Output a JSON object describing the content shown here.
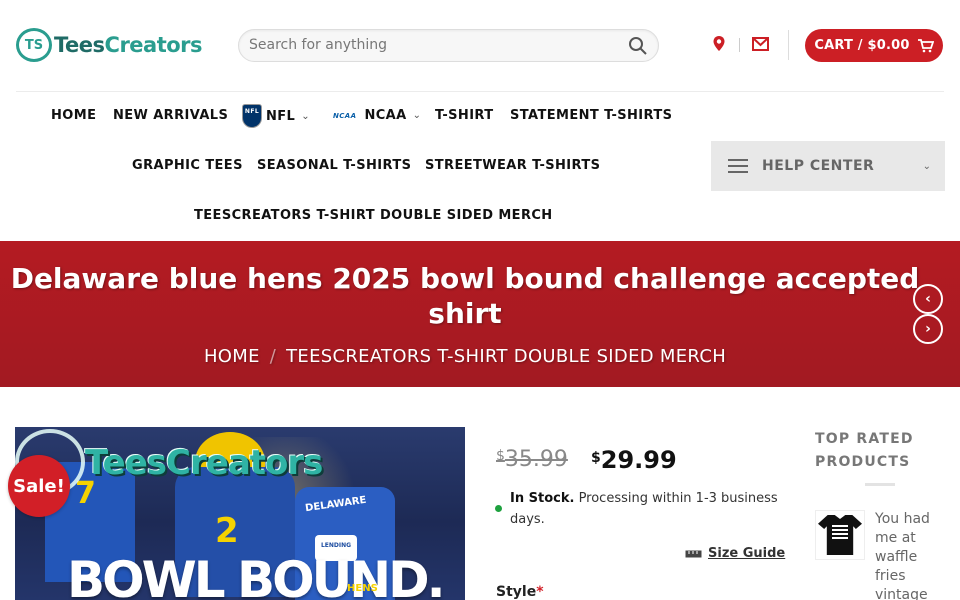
{
  "header": {
    "logo_mark": "TS",
    "logo_text_1": "Tees",
    "logo_text_2": "Creators",
    "search_placeholder": "Search for anything",
    "cart_label": "CART / $0.00"
  },
  "nav": {
    "row1": [
      "HOME",
      "NEW ARRIVALS",
      "NFL",
      "NCAA",
      "T-SHIRT",
      "STATEMENT T-SHIRTS"
    ],
    "row2": [
      "GRAPHIC TEES",
      "SEASONAL T-SHIRTS",
      "STREETWEAR T-SHIRTS"
    ],
    "row3": [
      "TEESCREATORS T-SHIRT DOUBLE SIDED MERCH"
    ],
    "nfl_badge": "NFL",
    "ncaa_badge": "NCAA",
    "help_center": "HELP CENTER"
  },
  "banner": {
    "title": "Delaware blue hens 2025 bowl bound challenge accepted shirt",
    "crumbs": [
      "HOME",
      "TEESCREATORS T-SHIRT DOUBLE SIDED MERCH"
    ],
    "crumb_sep": "/"
  },
  "product": {
    "sale_badge": "Sale!",
    "image_watermark": "TeesCreators",
    "image_headline": "BOWL BOUND.",
    "image_jersey_text": "DELAWARE",
    "image_badge_text": "LENDING",
    "image_hens": "HENS",
    "jersey_num_1": "7",
    "jersey_num_2": "2",
    "currency": "$",
    "old_price": "35.99",
    "new_price": "29.99",
    "stock_strong": "In Stock.",
    "stock_text": "Processing within 1-3 business days.",
    "size_guide": "Size Guide",
    "style_label": "Style",
    "required_mark": "*"
  },
  "sidebar": {
    "title": "TOP RATED PRODUCTS",
    "item_text": "You had me at waffle fries vintage"
  },
  "colors": {
    "brand_red": "#cc1f25",
    "banner_red": "#a91b22",
    "teal": "#2a9d8f",
    "stock_green": "#1ea13f"
  }
}
